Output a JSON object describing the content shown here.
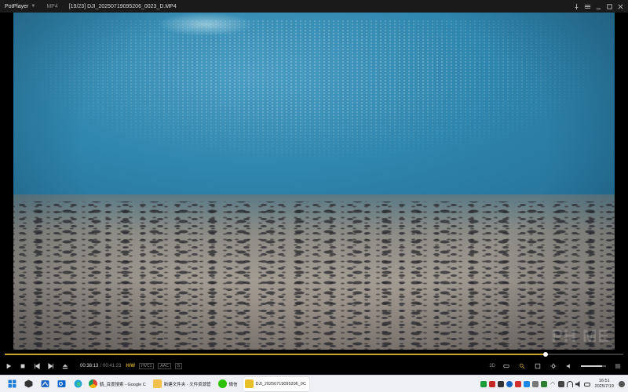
{
  "titlebar": {
    "app_name": "PotPlayer",
    "format": "MP4",
    "file_title": "[19/23] DJI_20250719095206_0023_D.MP4",
    "buttons": [
      "pin-icon",
      "menu-icon",
      "minimize-icon",
      "maximize-icon",
      "close-icon"
    ]
  },
  "video": {
    "watermark": "PH  ME"
  },
  "seekbar": {
    "progress": 0.874
  },
  "controls": {
    "current_time": "00:38:13",
    "separator": "/",
    "total_time": "00:41:23",
    "hw_badge": "H/W",
    "video_codec": "HVC1",
    "audio_codec": "AAC",
    "subtitle_badge": "S",
    "mode_3d": "3D",
    "volume": 0.85,
    "accent_color": "#c9a227"
  },
  "taskbar": {
    "apps": [
      {
        "label": "",
        "icon": "windows-start-icon"
      },
      {
        "label": "",
        "icon": "app-cube-icon"
      },
      {
        "label": "",
        "icon": "app-blue-icon"
      },
      {
        "label": "",
        "icon": "outlook-icon"
      },
      {
        "label": "",
        "icon": "edge-icon"
      },
      {
        "label": "鹤_百度搜索 - Google C",
        "icon": "chrome-icon"
      },
      {
        "label": "新建文件夹 - 文件资源管",
        "icon": "folder-icon"
      },
      {
        "label": "微信",
        "icon": "wechat-icon"
      },
      {
        "label": "DJI_20250719095206_0C",
        "icon": "potplayer-icon",
        "active": true
      }
    ],
    "clock": {
      "time": "16:51",
      "date": "2025/7/19"
    }
  }
}
